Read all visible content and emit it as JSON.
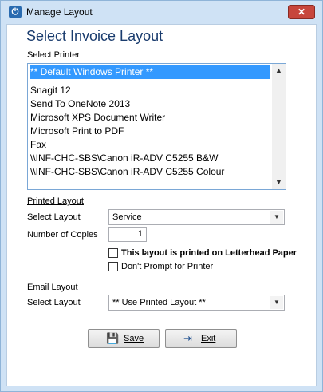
{
  "window": {
    "title": "Manage Layout",
    "close_glyph": "✕"
  },
  "heading": "Select Invoice Layout",
  "printer": {
    "label": "Select Printer",
    "items": [
      "** Default Windows Printer **",
      "Snagit 12",
      "Send To OneNote 2013",
      "Microsoft XPS Document Writer",
      "Microsoft Print to PDF",
      "Fax",
      "\\\\INF-CHC-SBS\\Canon iR-ADV C5255 B&W",
      "\\\\INF-CHC-SBS\\Canon iR-ADV C5255 Colour"
    ],
    "selected_index": 0
  },
  "printed_layout": {
    "section_label": "Printed Layout",
    "select_layout_label": "Select Layout",
    "select_layout_value": "Service",
    "copies_label": "Number of Copies",
    "copies_value": "1",
    "letterhead_label": "This layout is printed on Letterhead Paper",
    "letterhead_checked": false,
    "no_prompt_label": "Don't Prompt for Printer",
    "no_prompt_checked": false
  },
  "email_layout": {
    "section_label": "Email Layout",
    "select_layout_label": "Select Layout",
    "select_layout_value": "** Use Printed Layout **"
  },
  "buttons": {
    "save": "Save",
    "exit": "Exit"
  },
  "icons": {
    "app": "power-icon",
    "save": "floppy-disk-icon",
    "exit": "exit-door-icon"
  },
  "colors": {
    "selection": "#3399ff",
    "heading": "#1a3c6e",
    "close": "#c7463c"
  }
}
